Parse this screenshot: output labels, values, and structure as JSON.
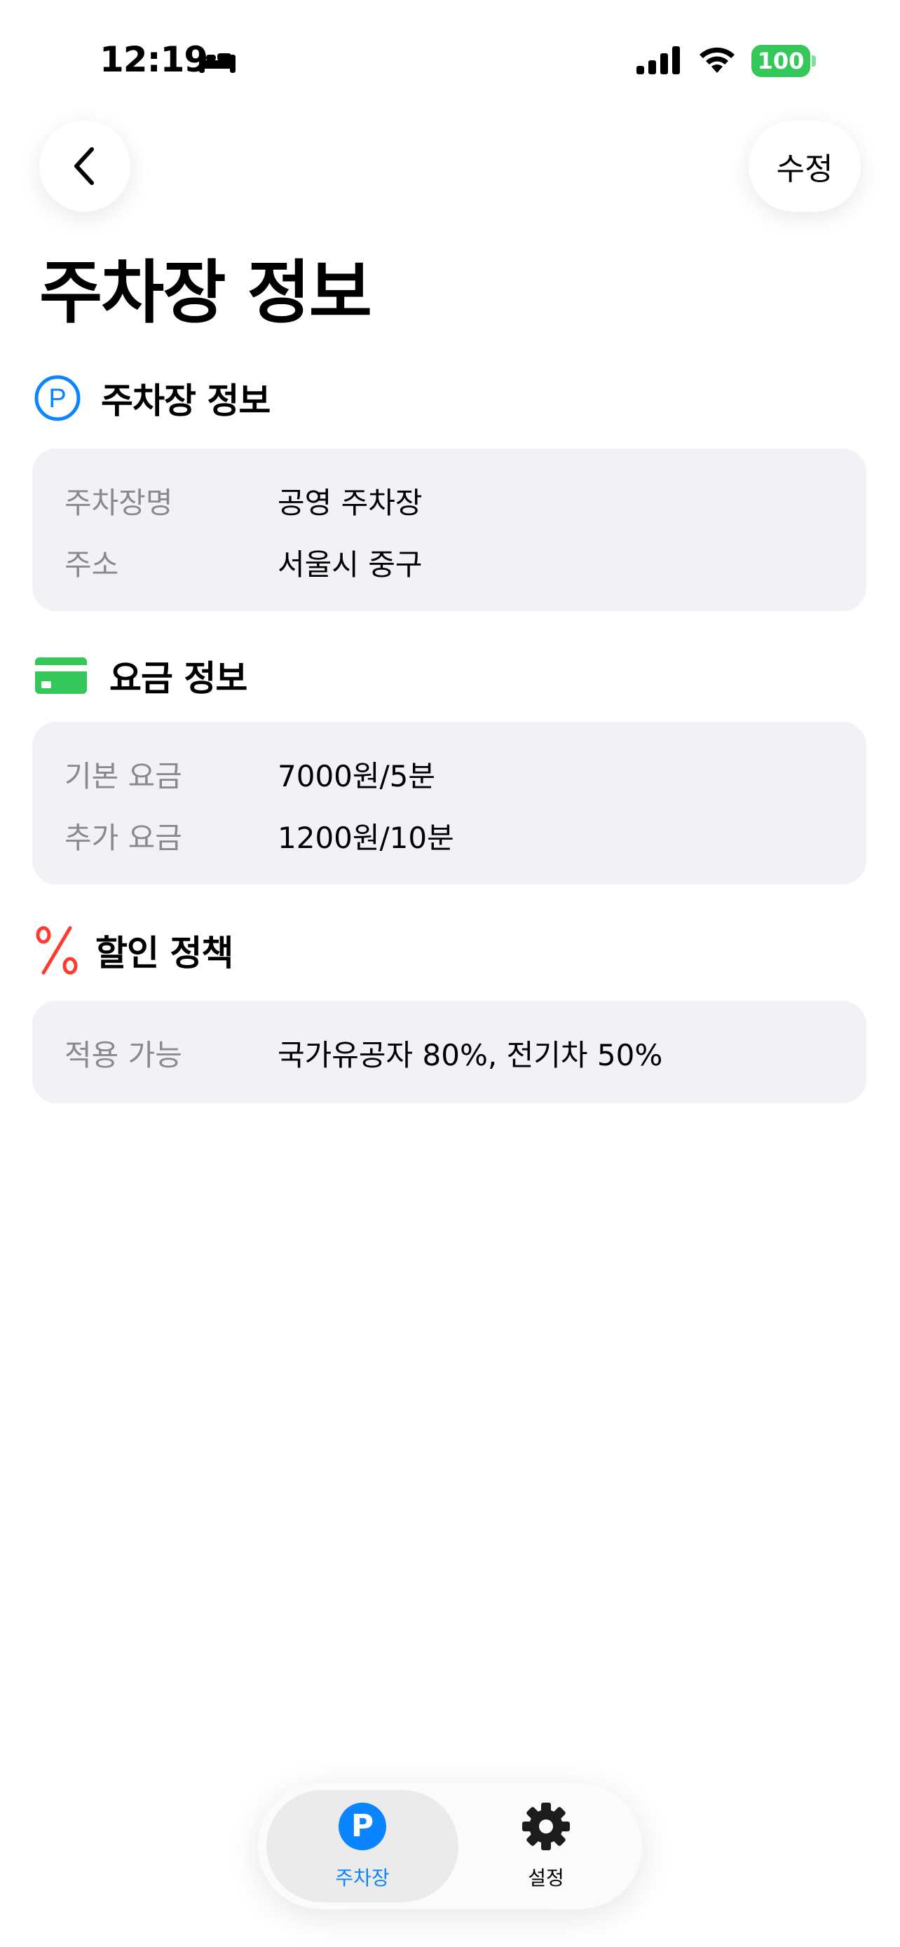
{
  "status_bar": {
    "time": "12:19",
    "battery": "100"
  },
  "nav": {
    "edit_label": "수정"
  },
  "page_title": "주차장 정보",
  "sections": [
    {
      "title": "주차장 정보",
      "icon": "parking-icon",
      "rows": [
        {
          "label": "주차장명",
          "value": "공영 주차장"
        },
        {
          "label": "주소",
          "value": "서울시 중구"
        }
      ]
    },
    {
      "title": "요금 정보",
      "icon": "credit-card-icon",
      "rows": [
        {
          "label": "기본 요금",
          "value": "7000원/5분"
        },
        {
          "label": "추가 요금",
          "value": "1200원/10분"
        }
      ]
    },
    {
      "title": "할인 정책",
      "icon": "percent-icon",
      "rows": [
        {
          "label": "적용 가능",
          "value": "국가유공자 80%, 전기차 50%"
        }
      ]
    }
  ],
  "tabs": [
    {
      "label": "주차장",
      "icon": "parking-icon",
      "selected": true
    },
    {
      "label": "설정",
      "icon": "gear-icon",
      "selected": false
    }
  ],
  "colors": {
    "accent_blue": "#0a84ff",
    "card_green": "#34c759",
    "percent_red": "#ff3b30",
    "card_bg": "#f1f1f6",
    "label_gray": "#8a8a8e"
  }
}
